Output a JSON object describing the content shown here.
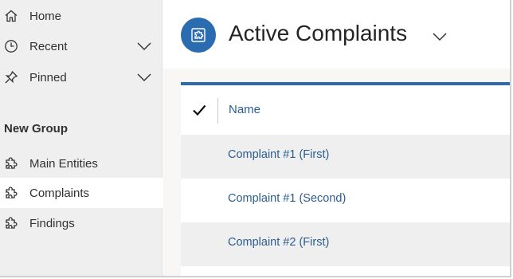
{
  "sidebar": {
    "items": [
      {
        "label": "Home",
        "icon": "home-icon"
      },
      {
        "label": "Recent",
        "icon": "clock-icon"
      },
      {
        "label": "Pinned",
        "icon": "pin-icon"
      }
    ],
    "group_title": "New Group",
    "group_items": [
      {
        "label": "Main Entities",
        "icon": "puzzle-icon"
      },
      {
        "label": "Complaints",
        "icon": "puzzle-icon",
        "active": true
      },
      {
        "label": "Findings",
        "icon": "puzzle-icon"
      }
    ]
  },
  "main": {
    "view_title": "Active Complaints",
    "grid": {
      "column_name": "Name",
      "rows": [
        "Complaint #1 (First)",
        "Complaint #1 (Second)",
        "Complaint #2 (First)"
      ]
    }
  },
  "colors": {
    "accent": "#2b6cb0",
    "link": "#2b5d91",
    "sidebar_bg": "#efefef"
  }
}
